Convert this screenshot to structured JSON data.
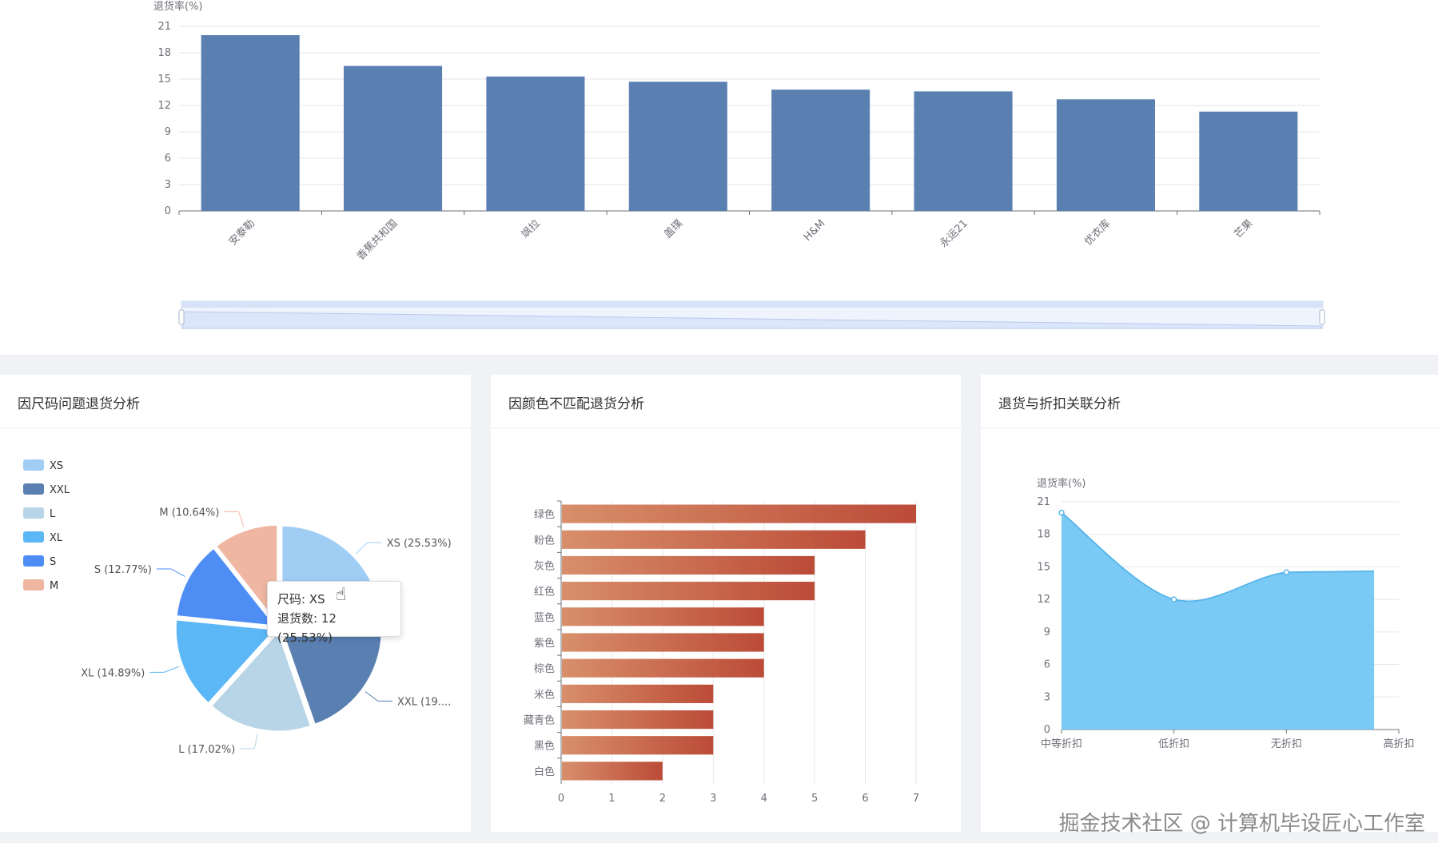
{
  "top_chart": {
    "ylabel": "退货率(%)"
  },
  "size_card": {
    "title": "因尺码问题退货分析"
  },
  "color_card": {
    "title": "因颜色不匹配退货分析"
  },
  "discount_card": {
    "title": "退货与折扣关联分析",
    "ylabel": "退货率(%)"
  },
  "tooltip": {
    "line1": "尺码: XS",
    "line2": "退货数: 12 (25.53%)"
  },
  "watermark": "掘金技术社区 @ 计算机毕设匠心工作室",
  "colors": {
    "bar_blue": "#5a7fb1",
    "pie_xs": "#9fcdf4",
    "pie_xxl": "#5a7fb1",
    "pie_l": "#b7d5e6",
    "pie_xl": "#5cb7f6",
    "pie_s": "#4e8ef4",
    "pie_m": "#efb7a1",
    "area_fill": "#74c7f5",
    "area_line": "#5ab6ea",
    "hbar_start": "#d88f6b",
    "hbar_end": "#bb4b38"
  },
  "chart_data": [
    {
      "type": "bar",
      "categories": [
        "安泰勒",
        "香蕉共和国",
        "飒拉",
        "盖璞",
        "H&M",
        "永运21",
        "优衣库",
        "芒果"
      ],
      "values": [
        20,
        16.5,
        15.3,
        14.7,
        13.8,
        13.6,
        12.7,
        11.3
      ],
      "ylabel": "退货率(%)",
      "yticks": [
        0,
        3,
        6,
        9,
        12,
        15,
        18,
        21
      ],
      "ylim": [
        0,
        21
      ],
      "grid": true,
      "datazoom": true
    },
    {
      "type": "pie",
      "labels": [
        "XS",
        "XXL",
        "L",
        "XL",
        "S",
        "M"
      ],
      "values": [
        12,
        9,
        8,
        7,
        6,
        5
      ],
      "percent_labels": [
        "XS (25.53%)",
        "XXL (19....",
        "L (17.02%)",
        "XL (14.89%)",
        "S (12.77%)",
        "M (10.64%)"
      ],
      "legend": [
        "XS",
        "XXL",
        "L",
        "XL",
        "S",
        "M"
      ],
      "legend_position": "left"
    },
    {
      "type": "bar",
      "orientation": "horizontal",
      "categories": [
        "绿色",
        "粉色",
        "灰色",
        "红色",
        "蓝色",
        "紫色",
        "棕色",
        "米色",
        "藏青色",
        "黑色",
        "白色"
      ],
      "values": [
        7,
        6,
        5,
        5,
        4,
        4,
        4,
        3,
        3,
        3,
        2
      ],
      "xticks": [
        0,
        1,
        2,
        3,
        4,
        5,
        6,
        7
      ],
      "xlim": [
        0,
        7
      ],
      "grid": true
    },
    {
      "type": "area",
      "categories": [
        "中等折扣",
        "低折扣",
        "无折扣",
        "高折扣"
      ],
      "values": [
        20,
        12,
        14.5,
        14.6
      ],
      "ylabel": "退货率(%)",
      "yticks": [
        0,
        3,
        6,
        9,
        12,
        15,
        18,
        21
      ],
      "ylim": [
        0,
        21
      ],
      "grid": true
    }
  ]
}
